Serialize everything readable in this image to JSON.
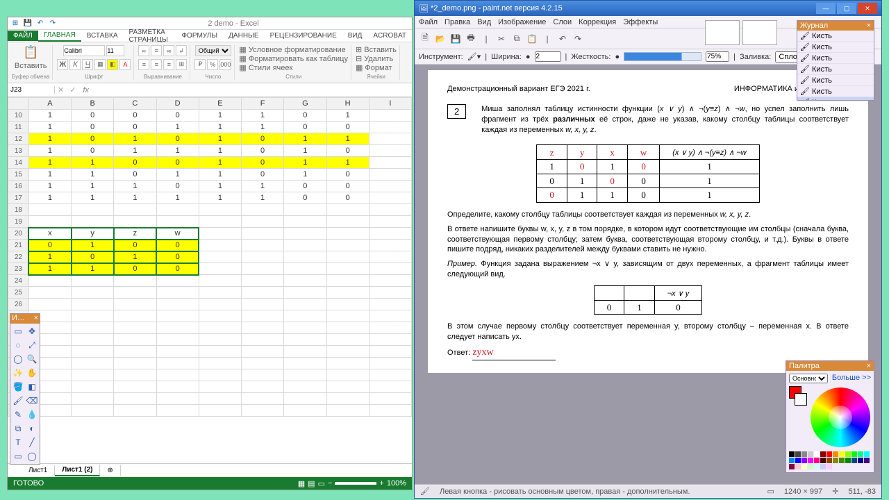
{
  "excel": {
    "title": "2 demo - Excel",
    "tabs": [
      "ФАЙЛ",
      "ГЛАВНАЯ",
      "ВСТАВКА",
      "РАЗМЕТКА СТРАНИЦЫ",
      "ФОРМУЛЫ",
      "ДАННЫЕ",
      "РЕЦЕНЗИРОВАНИЕ",
      "ВИД",
      "ACROBAT"
    ],
    "active_tab": "ГЛАВНАЯ",
    "groups": {
      "clipboard": "Буфер обмена",
      "paste": "Вставить",
      "font": "Шрифт",
      "align": "Выравнивание",
      "number": "Число",
      "styles": "Стили",
      "cells": "Ячейки",
      "font_name": "Calibri",
      "font_size": "11",
      "number_fmt": "Общий",
      "cond_fmt": "Условное форматирование",
      "as_table": "Форматировать как таблицу",
      "cell_styles": "Стили ячеек",
      "insert": "Вставить",
      "delete": "Удалить",
      "format": "Формат"
    },
    "cell_ref": "J23",
    "columns": [
      "A",
      "B",
      "C",
      "D",
      "E",
      "F",
      "G",
      "H",
      "I"
    ],
    "rows": [
      {
        "n": 10,
        "v": [
          "1",
          "0",
          "0",
          "0",
          "1",
          "1",
          "0",
          "1",
          ""
        ]
      },
      {
        "n": 11,
        "v": [
          "1",
          "0",
          "0",
          "1",
          "1",
          "1",
          "0",
          "0",
          ""
        ]
      },
      {
        "n": 12,
        "v": [
          "1",
          "0",
          "1",
          "0",
          "1",
          "0",
          "1",
          "1",
          ""
        ],
        "hl": true
      },
      {
        "n": 13,
        "v": [
          "1",
          "0",
          "1",
          "1",
          "1",
          "0",
          "1",
          "0",
          ""
        ]
      },
      {
        "n": 14,
        "v": [
          "1",
          "1",
          "0",
          "0",
          "1",
          "0",
          "1",
          "1",
          ""
        ],
        "hl": true
      },
      {
        "n": 15,
        "v": [
          "1",
          "1",
          "0",
          "1",
          "1",
          "0",
          "1",
          "0",
          ""
        ]
      },
      {
        "n": 16,
        "v": [
          "1",
          "1",
          "1",
          "0",
          "1",
          "1",
          "0",
          "0",
          ""
        ]
      },
      {
        "n": 17,
        "v": [
          "1",
          "1",
          "1",
          "1",
          "1",
          "1",
          "0",
          "0",
          ""
        ]
      },
      {
        "n": 18,
        "v": [
          "",
          "",
          "",
          "",
          "",
          "",
          "",
          "",
          ""
        ]
      },
      {
        "n": 19,
        "v": [
          "",
          "",
          "",
          "",
          "",
          "",
          "",
          "",
          ""
        ]
      },
      {
        "n": 20,
        "v": [
          "x",
          "y",
          "z",
          "w",
          "",
          "",
          "",
          "",
          ""
        ],
        "hdr": true
      },
      {
        "n": 21,
        "v": [
          "0",
          "1",
          "0",
          "0",
          "",
          "",
          "",
          "",
          ""
        ],
        "hl2": true
      },
      {
        "n": 22,
        "v": [
          "1",
          "0",
          "1",
          "0",
          "",
          "",
          "",
          "",
          ""
        ],
        "hl2": true
      },
      {
        "n": 23,
        "v": [
          "1",
          "1",
          "0",
          "0",
          "",
          "",
          "",
          "",
          ""
        ],
        "hl2": true
      }
    ],
    "sheets": [
      "Лист1",
      "Лист1 (2)"
    ],
    "status": "ГОТОВО",
    "zoom": "100%"
  },
  "paintnet": {
    "title": "*2_demo.png - paint.net версия 4.2.15",
    "menu": [
      "Файл",
      "Правка",
      "Вид",
      "Изображение",
      "Слои",
      "Коррекция",
      "Эффекты"
    ],
    "opts": {
      "tool": "Инструмент:",
      "width": "Ширина:",
      "width_v": "2",
      "hard": "Жесткость:",
      "hard_v": "75%",
      "fill": "Заливка:",
      "fill_v": "Сплошной цвет"
    },
    "journal": {
      "title": "Журнал",
      "items": [
        "Кисть",
        "Кисть",
        "Кисть",
        "Кисть",
        "Кисть",
        "Кисть",
        "Кисть"
      ]
    },
    "palette": {
      "title": "Палитра",
      "primary": "Основной",
      "more": "Больше >>"
    },
    "status": {
      "hint": "Левая кнопка - рисовать основным цветом, правая - дополнительным.",
      "dims": "1240 × 997",
      "pos": "511, -83"
    },
    "doc": {
      "hdr_left": "Демонстрационный вариант ЕГЭ 2021 г.",
      "hdr_right": "ИНФОРМАТИКА и ИКТ, 11 класс",
      "qnum": "2",
      "p1a": "Миша заполнял таблицу истинности функции (",
      "p1b": ") ∧ ¬(",
      "p1c": ") ∧ ¬",
      "p1d": ", но успел заполнить лишь фрагмент из трёх ",
      "p1e": "различных",
      "p1f": " её строк, даже не указав, какому столбцу таблицы соответствует каждая из переменных ",
      "vars": "w, x, y, z",
      "fx": "x ∨ y",
      "fy": "y≡z",
      "fw": "w",
      "truth_head": [
        "z",
        "y",
        "x",
        "w",
        "(x ∨ y) ∧ ¬(y≡z) ∧ ¬w"
      ],
      "truth_rows": [
        [
          "1",
          "0",
          "1",
          "0",
          "1"
        ],
        [
          "0",
          "1",
          "0",
          "0",
          "1"
        ],
        [
          "0",
          "1",
          "1",
          "0",
          "1"
        ]
      ],
      "p2": "Определите, какому столбцу таблицы соответствует каждая из переменных ",
      "p3": "В ответе напишите буквы w, x, y, z в том порядке, в котором идут соответствующие им столбцы (сначала буква, соответствующая первому столбцу; затем буква, соответствующая второму столбцу, и т.д.). Буквы в ответе пишите подряд, никаких разделителей между буквами ставить не нужно.",
      "p4a": "Пример.",
      "p4b": " Функция задана выражением ¬x ∨ y, зависящим от двух переменных, а фрагмент таблицы имеет следующий вид.",
      "ex_head": [
        "",
        "",
        "¬x ∨ y"
      ],
      "ex_row": [
        "0",
        "1",
        "0"
      ],
      "p5": "В этом случае первому столбцу соответствует переменная y, второму столбцу – переменная x. В ответе следует написать yx.",
      "ans_lab": "Ответ:",
      "ans": "zyxw"
    }
  },
  "toolbox": {
    "title": "И…",
    "close": "×"
  }
}
